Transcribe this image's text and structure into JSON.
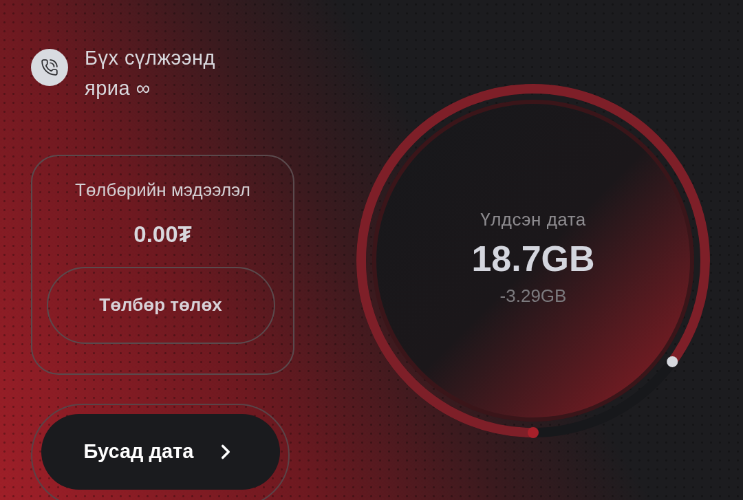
{
  "plan": {
    "title": "Бүх сүлжээнд яриа ∞"
  },
  "payment": {
    "title": "Төлбөрийн мэдээлэл",
    "amount": "0.00₮",
    "button": "Төлбөр төлөх"
  },
  "more_button": {
    "label": "Бусад дата"
  },
  "data_gauge": {
    "label": "Үлдсэн дата",
    "value": "18.7GB",
    "change": "-3.29GB",
    "level": 0.85
  }
}
